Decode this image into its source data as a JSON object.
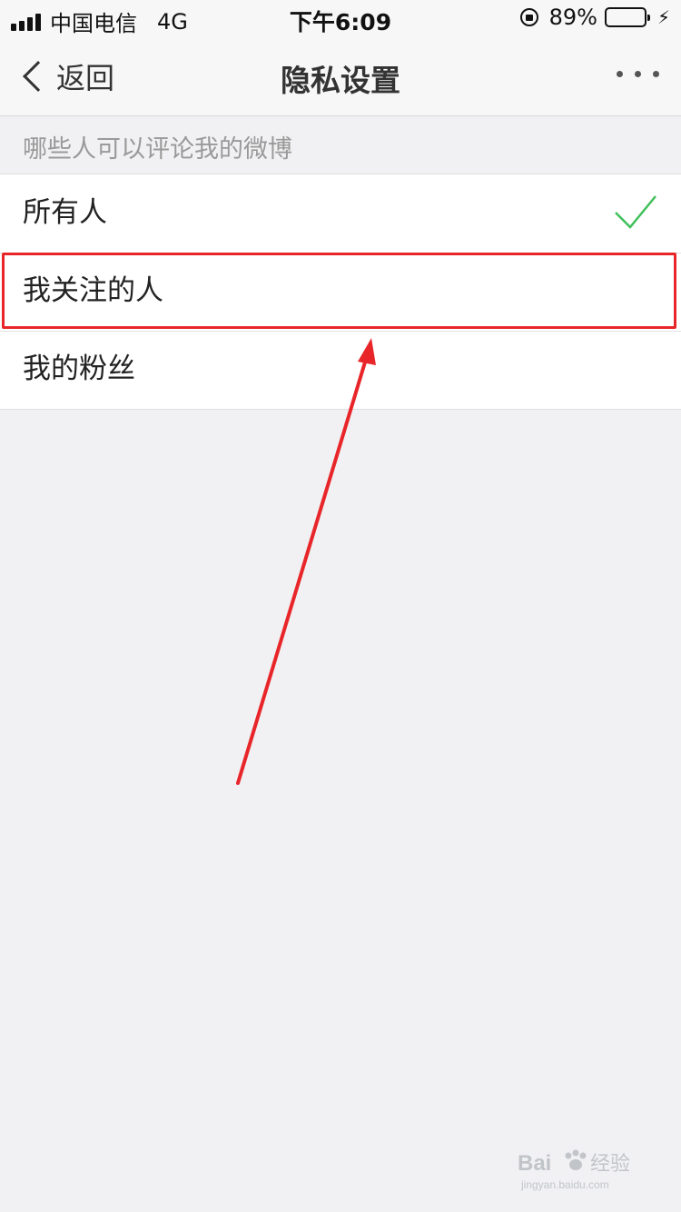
{
  "status_bar": {
    "carrier": "中国电信",
    "network": "4G",
    "time": "下午6:09",
    "battery": "89%",
    "battery_level": 0.89
  },
  "nav": {
    "back_label": "返回",
    "title": "隐私设置"
  },
  "section": {
    "header": "哪些人可以评论我的微博"
  },
  "options": [
    {
      "label": "所有人",
      "selected": true
    },
    {
      "label": "我关注的人",
      "selected": false
    },
    {
      "label": "我的粉丝",
      "selected": false
    }
  ],
  "colors": {
    "check": "#3fc05a",
    "annotation": "#e8262a",
    "battery": "#4cd964"
  },
  "watermark": {
    "logo": "Baidu 经验",
    "url": "jingyan.baidu.com"
  }
}
